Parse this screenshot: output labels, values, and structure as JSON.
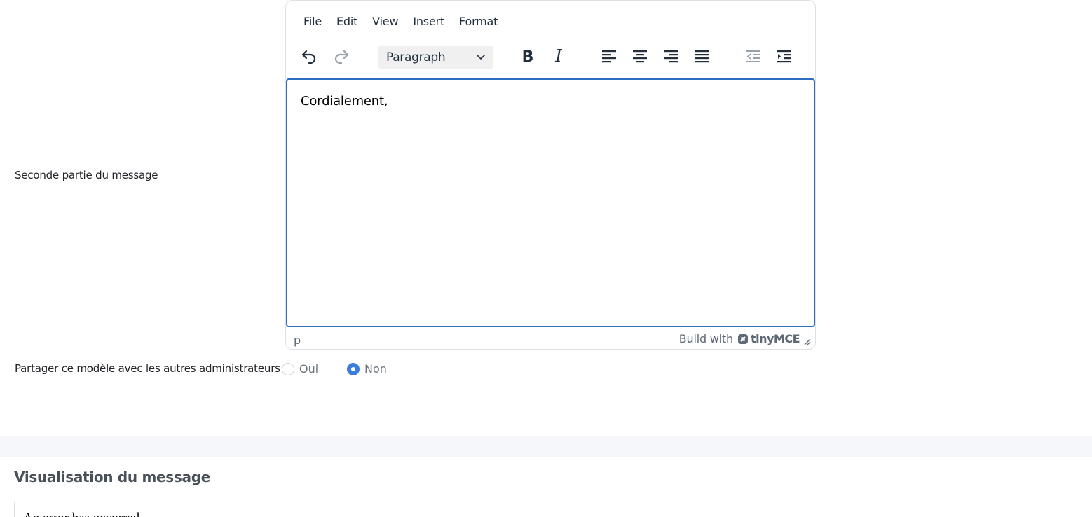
{
  "form": {
    "second_part_label": "Seconde partie du message",
    "share_label": "Partager ce modèle avec les autres administrateurs",
    "share_options": [
      {
        "label": "Oui",
        "checked": false
      },
      {
        "label": "Non",
        "checked": true
      }
    ]
  },
  "editor": {
    "menu": [
      "File",
      "Edit",
      "View",
      "Insert",
      "Format"
    ],
    "block_format": "Paragraph",
    "toolbar_icons": [
      "undo-icon",
      "redo-icon",
      "bold-icon",
      "italic-icon",
      "align-left-icon",
      "align-center-icon",
      "align-right-icon",
      "align-justify-icon",
      "outdent-icon",
      "indent-icon"
    ],
    "content": "Cordialement,",
    "status_path": "p",
    "branding_prefix": "Build with",
    "branding_name": "tinyMCE"
  },
  "preview": {
    "title": "Visualisation du message",
    "body": "An error has occurred"
  },
  "colors": {
    "accent": "#3b7ddd",
    "focus_border": "#2c6fc2",
    "band": "#f5f7fb"
  }
}
